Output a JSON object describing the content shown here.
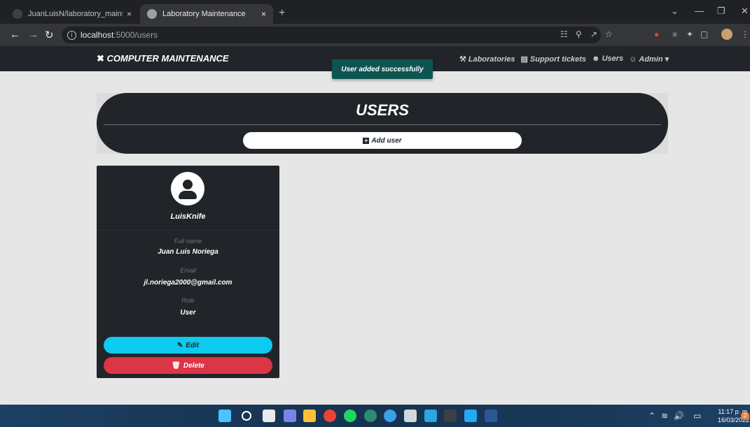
{
  "browser": {
    "tabs": [
      {
        "title": "JuanLuisN/laboratory_maintenan",
        "close": "×"
      },
      {
        "title": "Laboratory Maintenance",
        "close": "×"
      }
    ],
    "new_tab": "+",
    "url_host": "localhost",
    "url_path": ":5000/users"
  },
  "navbar": {
    "brand": "COMPUTER MAINTENANCE",
    "links": [
      {
        "icon": "laboratory-icon",
        "label": "Laboratories"
      },
      {
        "icon": "ticket-icon",
        "label": "Support tickets"
      },
      {
        "icon": "users-icon",
        "label": "Users"
      },
      {
        "icon": "user-icon",
        "label": "Admin"
      }
    ]
  },
  "toast": {
    "message": "User added successfully",
    "color": "#0e5552"
  },
  "page": {
    "title": "USERS",
    "add_button": "Add user"
  },
  "user_card": {
    "username": "LuisKnife",
    "full_name_label": "Full name",
    "full_name": "Juan Luis Noriega",
    "email_label": "Email",
    "email": "jl.noriega2000@gmail.com",
    "role_label": "Role",
    "role": "User",
    "edit_label": "Edit",
    "delete_label": "Delete"
  },
  "taskbar": {
    "time": "11:17 p. m.",
    "date": "16/03/2022",
    "notifications": "2"
  },
  "colors": {
    "navbar_bg": "#212529",
    "edit": "#0dcaf0",
    "delete": "#dc3545"
  }
}
